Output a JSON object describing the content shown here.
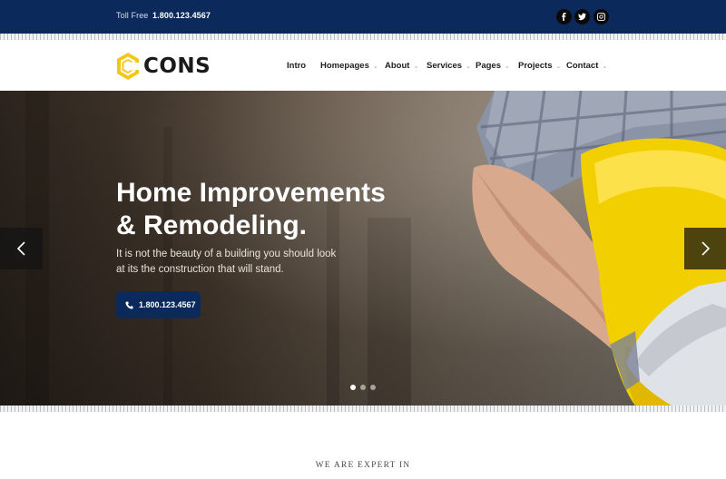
{
  "topbar": {
    "toll_label": "Toll Free",
    "toll_number": "1.800.123.4567",
    "social": [
      "facebook-icon",
      "twitter-icon",
      "instagram-icon"
    ]
  },
  "brand": {
    "name": "CONS",
    "accent": "#f5c518"
  },
  "nav": [
    {
      "label": "Intro",
      "dropdown": false
    },
    {
      "label": "Homepages",
      "dropdown": true
    },
    {
      "label": "About",
      "dropdown": true
    },
    {
      "label": "Services",
      "dropdown": true
    },
    {
      "label": "Pages",
      "dropdown": true
    },
    {
      "label": "Projects",
      "dropdown": true
    },
    {
      "label": "Contact",
      "dropdown": true
    }
  ],
  "hero": {
    "title_line1": "Home Improvements",
    "title_line2": "& Remodeling.",
    "subtitle_line1": "It is not the beauty of a building you should look",
    "subtitle_line2": "at its the construction that will stand.",
    "cta_label": "1.800.123.4567",
    "slides_total": 3,
    "slide_active": 1
  },
  "section": {
    "eyebrow": "WE ARE EXPERT IN"
  },
  "colors": {
    "navy": "#0b2a5b",
    "helmet": "#f5d000"
  }
}
